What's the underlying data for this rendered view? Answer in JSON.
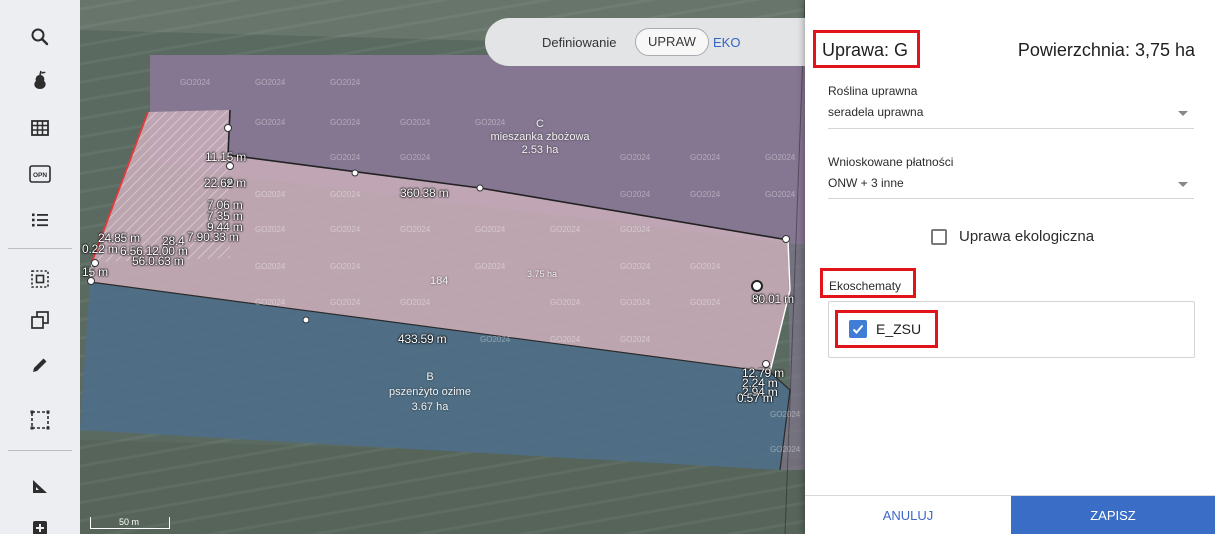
{
  "toolbar": {
    "icons": [
      "search-icon",
      "pear-icon",
      "table-grid-icon",
      "opn-icon",
      "list-icon",
      "select-area-icon",
      "copy-icon",
      "pencil-icon",
      "frame-select-icon",
      "measure-icon",
      "add-icon"
    ],
    "opn_label": "OPN"
  },
  "map": {
    "mode_toggle": {
      "caption": "Definiowanie",
      "active": "UPRAW",
      "inactive": "EKO"
    },
    "watermark": "GO2024",
    "plots": {
      "c": {
        "letter": "C",
        "crop": "mieszanka zbożowa",
        "area": "2.53 ha"
      },
      "g": {
        "number": "184",
        "area": "3.75 ha"
      },
      "b": {
        "letter": "B",
        "crop": "pszenżyto ozime",
        "area": "3.67 ha"
      }
    },
    "measurements": {
      "m1": "11.15 m",
      "m2": "22.62 m",
      "m3": "7.06 m",
      "m4": "7.35 m",
      "m5": "9.44 m",
      "m6": "7.90.33 m",
      "m7": "24.85 m",
      "m8": "28.4",
      "m9": "0.22 m",
      "m10": "6.56.12.00 m",
      "m11": "56.0.63 m",
      "m12": "15 m",
      "m13": "360.38 m",
      "m14": "433.59 m",
      "m15": "80.01 m",
      "m16": "12.79 m",
      "m17": "2.24 m",
      "m18": "2.94 m",
      "m19": "0.57 m"
    },
    "scale": "50 m",
    "colors": {
      "plot_c": "#8a7897",
      "plot_g": "#c6aab7",
      "plot_b": "#4f6f87"
    }
  },
  "panel": {
    "title": "Uprawa: G",
    "area": "Powierzchnia: 3,75 ha",
    "crop_field": {
      "label": "Roślina uprawna",
      "value": "seradela uprawna"
    },
    "payments_field": {
      "label": "Wnioskowane płatności",
      "value": "ONW + 3 inne"
    },
    "organic_checkbox": {
      "label": "Uprawa ekologiczna",
      "checked": false
    },
    "ecoschemes": {
      "label": "Ekoschematy",
      "items": [
        {
          "label": "E_ZSU",
          "checked": true
        }
      ]
    },
    "buttons": {
      "cancel": "ANULUJ",
      "save": "ZAPISZ"
    },
    "colors": {
      "highlight": "#e1141b",
      "accent": "#3a6dc5",
      "checkbox": "#3f7dd6"
    }
  }
}
